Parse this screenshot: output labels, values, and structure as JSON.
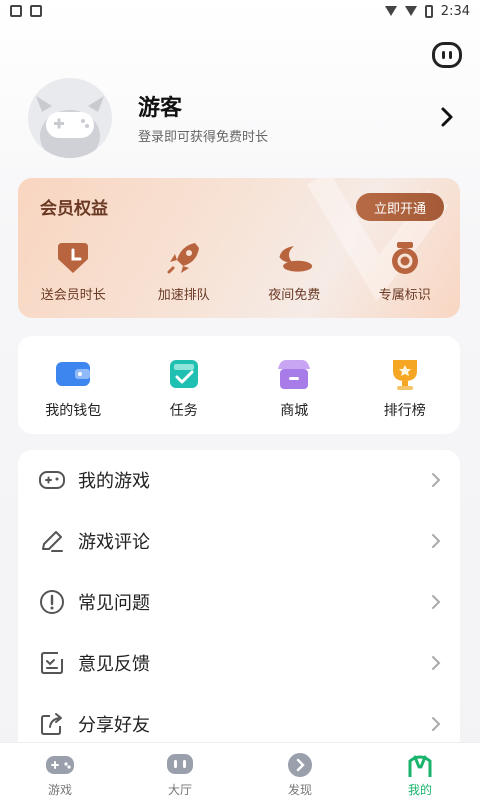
{
  "status": {
    "time": "2:34"
  },
  "profile": {
    "name": "游客",
    "subtitle": "登录即可获得免费时长"
  },
  "vip": {
    "title": "会员权益",
    "action": "立即开通",
    "items": [
      {
        "label": "送会员时长",
        "icon": "vip-time-icon"
      },
      {
        "label": "加速排队",
        "icon": "rocket-icon"
      },
      {
        "label": "夜间免费",
        "icon": "moon-icon"
      },
      {
        "label": "专属标识",
        "icon": "badge-icon"
      }
    ]
  },
  "quick": [
    {
      "label": "我的钱包",
      "icon": "wallet-icon"
    },
    {
      "label": "任务",
      "icon": "task-icon"
    },
    {
      "label": "商城",
      "icon": "store-icon"
    },
    {
      "label": "排行榜",
      "icon": "trophy-icon"
    }
  ],
  "menu": [
    {
      "label": "我的游戏",
      "icon": "gamepad-icon"
    },
    {
      "label": "游戏评论",
      "icon": "pencil-icon"
    },
    {
      "label": "常见问题",
      "icon": "question-icon"
    },
    {
      "label": "意见反馈",
      "icon": "feedback-icon"
    },
    {
      "label": "分享好友",
      "icon": "share-icon"
    }
  ],
  "tabs": [
    {
      "label": "游戏",
      "icon": "game-tab-icon"
    },
    {
      "label": "大厅",
      "icon": "lobby-tab-icon"
    },
    {
      "label": "发现",
      "icon": "discover-tab-icon"
    },
    {
      "label": "我的",
      "icon": "mine-tab-icon"
    }
  ],
  "colors": {
    "accent": "#19b36b",
    "vip_text": "#6b3a24",
    "vip_button": "#a45a37"
  }
}
